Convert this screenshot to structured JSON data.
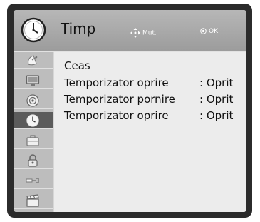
{
  "header": {
    "title": "Timp",
    "move_hint": "Mut.",
    "ok_hint": "OK",
    "icon": "clock-icon"
  },
  "sidebar": {
    "items": [
      {
        "icon": "satellite-dish-icon",
        "active": false
      },
      {
        "icon": "monitor-icon",
        "active": false
      },
      {
        "icon": "speaker-icon",
        "active": false
      },
      {
        "icon": "clock-icon",
        "active": true
      },
      {
        "icon": "toolbox-icon",
        "active": false
      },
      {
        "icon": "padlock-icon",
        "active": false
      },
      {
        "icon": "input-plug-icon",
        "active": false
      },
      {
        "icon": "clapperboard-icon",
        "active": false
      }
    ]
  },
  "menu": {
    "items": [
      {
        "label": "Ceas",
        "value": ""
      },
      {
        "label": "Temporizator oprire",
        "value": ": Oprit"
      },
      {
        "label": "Temporizator pornire",
        "value": ": Oprit"
      },
      {
        "label": "Temporizator oprire",
        "value": ": Oprit"
      }
    ]
  },
  "colors": {
    "frame": "#2b2b2b",
    "header": "#a9a9a9",
    "sidebar": "#bdbdbd",
    "sidebar_active": "#5b5b5b",
    "content": "#ececec"
  }
}
